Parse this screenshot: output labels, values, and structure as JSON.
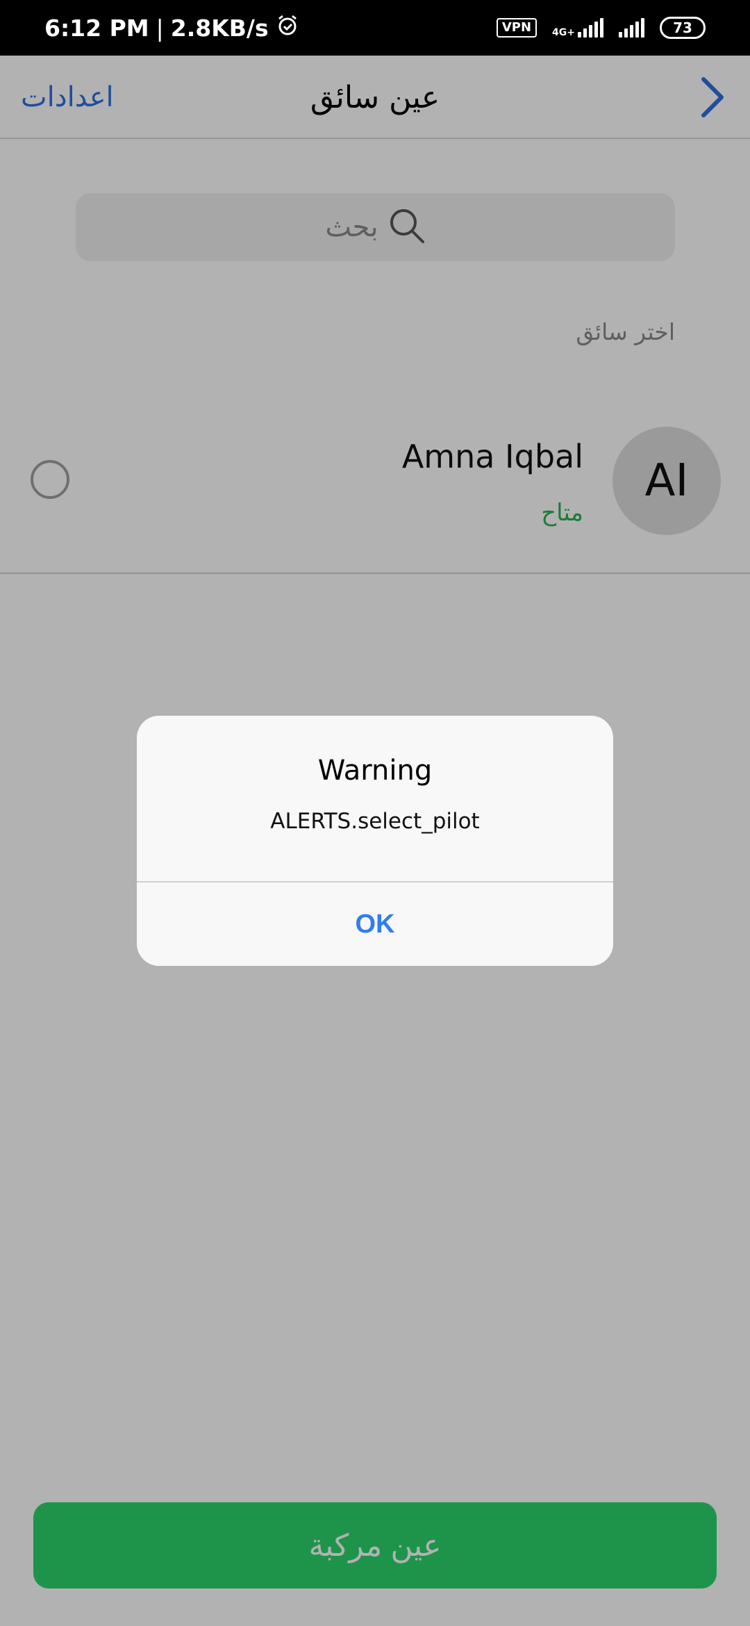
{
  "status_bar": {
    "time": "6:12 PM",
    "separator": "|",
    "speed": "2.8KB/s",
    "vpn": "VPN",
    "network": "4G+",
    "battery": "73"
  },
  "header": {
    "settings_label": "اعدادات",
    "title": "عين سائق"
  },
  "search": {
    "placeholder": "بحث"
  },
  "section_label": "اختر سائق",
  "driver": {
    "initials": "AI",
    "name": "Amna Iqbal",
    "status": "متاح"
  },
  "bottom_button": {
    "label": "عين مركبة"
  },
  "dialog": {
    "title": "Warning",
    "message": "ALERTS.select_pilot",
    "ok_label": "OK"
  },
  "colors": {
    "accent_blue": "#2f6fe0",
    "status_green": "#2bb152",
    "button_green": "#2bd56c",
    "dialog_ok": "#2f7df0"
  }
}
